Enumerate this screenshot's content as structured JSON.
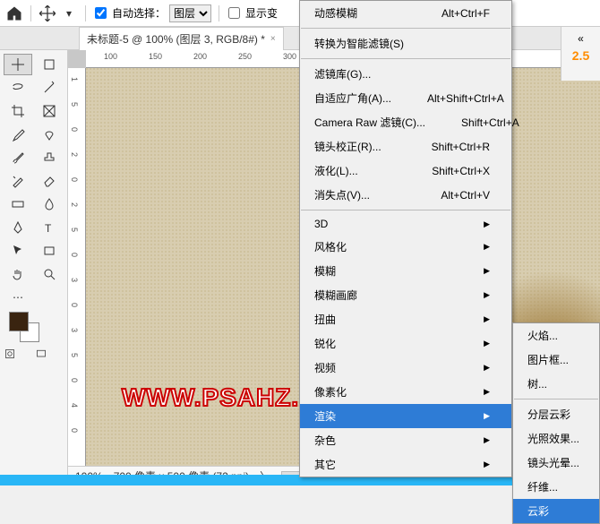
{
  "toolbar": {
    "auto_select_label": "自动选择：",
    "layer_dropdown": "图层",
    "show_transform_label": "显示变"
  },
  "tab": {
    "title": "未标题-5 @ 100% (图层 3, RGB/8#) *",
    "close": "×"
  },
  "ruler_h": [
    "100",
    "150",
    "200",
    "250",
    "300"
  ],
  "ruler_v": [
    "1",
    "5",
    "0",
    "2",
    "0",
    "2",
    "5",
    "0",
    "3",
    "0",
    "3",
    "5",
    "0",
    "4",
    "0"
  ],
  "watermark": "WWW.PSAHZ.COM",
  "status": {
    "zoom": "100%",
    "doc_info": "700 像素 x 500 像素 (72 ppi)",
    "arrow": "〉"
  },
  "right_panel": {
    "value": "2.5"
  },
  "menu1": {
    "items": [
      {
        "label": "动感模糊",
        "shortcut": "Alt+Ctrl+F"
      },
      {
        "sep": true
      },
      {
        "label": "转换为智能滤镜(S)"
      },
      {
        "sep": true
      },
      {
        "label": "滤镜库(G)..."
      },
      {
        "label": "自适应广角(A)...",
        "shortcut": "Alt+Shift+Ctrl+A"
      },
      {
        "label": "Camera Raw 滤镜(C)...",
        "shortcut": "Shift+Ctrl+A"
      },
      {
        "label": "镜头校正(R)...",
        "shortcut": "Shift+Ctrl+R"
      },
      {
        "label": "液化(L)...",
        "shortcut": "Shift+Ctrl+X"
      },
      {
        "label": "消失点(V)...",
        "shortcut": "Alt+Ctrl+V"
      },
      {
        "sep": true
      },
      {
        "label": "3D",
        "sub": true
      },
      {
        "label": "风格化",
        "sub": true
      },
      {
        "label": "模糊",
        "sub": true
      },
      {
        "label": "模糊画廊",
        "sub": true
      },
      {
        "label": "扭曲",
        "sub": true
      },
      {
        "label": "锐化",
        "sub": true
      },
      {
        "label": "视频",
        "sub": true
      },
      {
        "label": "像素化",
        "sub": true
      },
      {
        "label": "渲染",
        "sub": true,
        "hl": true
      },
      {
        "label": "杂色",
        "sub": true
      },
      {
        "label": "其它",
        "sub": true
      }
    ]
  },
  "menu2": {
    "items": [
      {
        "label": "火焰..."
      },
      {
        "label": "图片框..."
      },
      {
        "label": "树..."
      },
      {
        "sep": true
      },
      {
        "label": "分层云彩"
      },
      {
        "label": "光照效果..."
      },
      {
        "label": "镜头光晕..."
      },
      {
        "label": "纤维..."
      },
      {
        "label": "云彩",
        "hl": true
      }
    ]
  }
}
